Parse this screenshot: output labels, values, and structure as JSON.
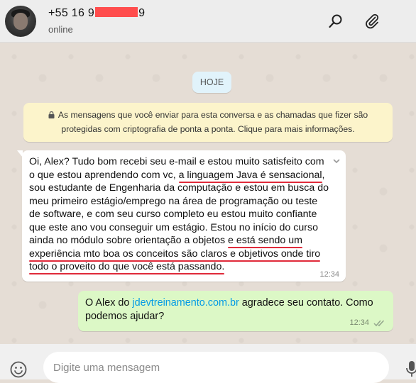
{
  "header": {
    "contact_prefix": "+55 16 9",
    "contact_suffix": "9",
    "status": "online"
  },
  "chat": {
    "day_label": "HOJE",
    "system_notice_line1": "As mensagens que você enviar para esta conversa e as chamadas que fizer são",
    "system_notice_line2": "protegidas com criptografia de ponta a ponta. Clique para mais informações.",
    "incoming": {
      "l1": "Oi, Alex? Tudo bom recebi seu e-mail e estou muito satisfeito com",
      "l2a": "o que estou aprendendo com vc, ",
      "l2b": "a linguagem Java  é sensacional",
      "l2c": ",",
      "l3": "sou estudante de Engenharia da computação e estou em busca do",
      "l4": "meu primeiro estágio/emprego na área de programação ou teste",
      "l5": "de software, e com seu curso completo eu estou muito confiante",
      "l6": "que este ano vou conseguir um estágio. Estou no início do curso",
      "l7a": "ainda no módulo sobre orientação a objetos ",
      "l7b": "e está sendo um",
      "l8": "experiência mto boa os conceitos são claros e objetivos onde tiro",
      "l9": "todo o proveito do que você está passando.",
      "time": "12:34"
    },
    "outgoing": {
      "text_a": "O Alex do ",
      "link": "jdevtreinamento.com.br",
      "text_b": " agradece seu contato. Como",
      "text_c": "podemos ajudar?",
      "time": "12:34"
    }
  },
  "composer": {
    "placeholder": "Digite uma mensagem"
  },
  "icons": {
    "search": "search-icon",
    "attach": "paperclip-icon",
    "emoji": "emoji-icon",
    "mic": "microphone-icon",
    "menu": "chevron-down-icon",
    "read": "double-check-icon",
    "lock": "lock-icon"
  },
  "colors": {
    "incoming_bubble": "#ffffff",
    "outgoing_bubble": "#dcf8c6",
    "notice_bg": "#fcf4cb",
    "link": "#039be5",
    "underline": "#e02a3a"
  }
}
